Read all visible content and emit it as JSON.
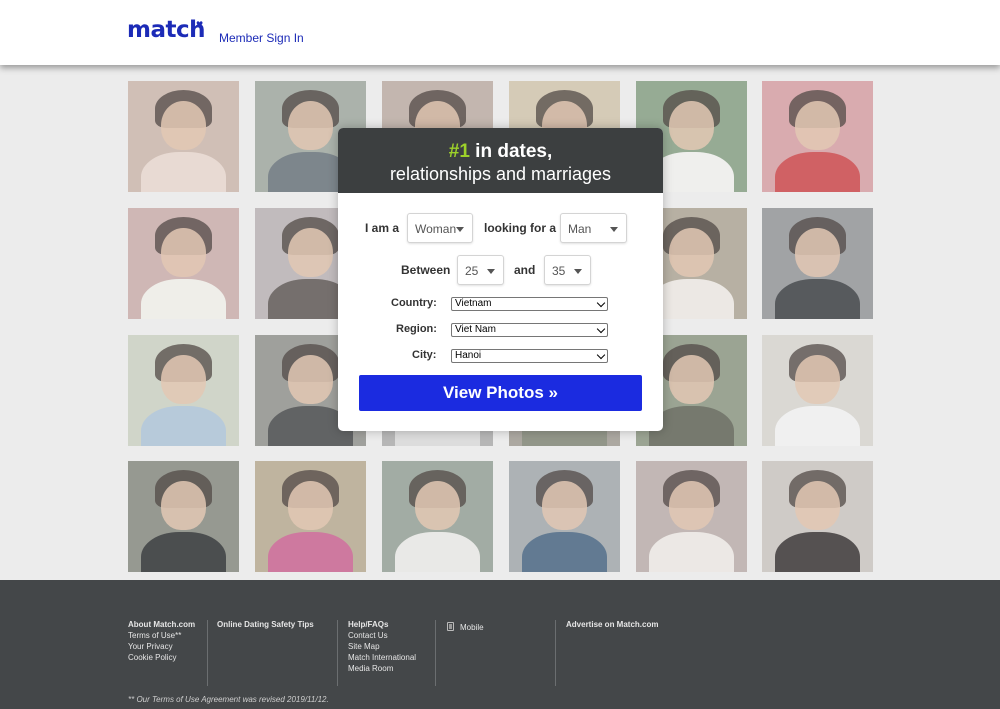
{
  "header": {
    "logo_text": "match",
    "member_sign_in": "Member Sign In"
  },
  "card": {
    "headline_number": "#1",
    "headline_rest": " in dates,",
    "subline": "relationships and marriages",
    "i_am_label": "I am a",
    "i_am_value": "Woman",
    "looking_label": "looking for a",
    "looking_value": "Man",
    "between_label": "Between",
    "age_min": "25",
    "and_label": "and",
    "age_max": "35",
    "country_label": "Country:",
    "country_value": "Vietnam",
    "region_label": "Region:",
    "region_value": "Viet Nam",
    "city_label": "City:",
    "city_value": "Hanoi",
    "button_label": "View Photos »"
  },
  "footer": {
    "col1": {
      "title": "About Match.com",
      "links": [
        "Terms of Use**",
        "Your Privacy",
        "Cookie Policy"
      ]
    },
    "col2": {
      "title": "Online Dating Safety Tips"
    },
    "col3": {
      "title": "Help/FAQs",
      "links": [
        "Contact Us",
        "Site Map",
        "Match International",
        "Media Room"
      ]
    },
    "col4": {
      "mobile_label": "Mobile"
    },
    "col5": {
      "title": "Advertise on Match.com"
    },
    "note": "** Our Terms of Use Agreement was revised 2019/11/12."
  },
  "colors": {
    "brand": "#1c2bb7",
    "button": "#1b2be0",
    "highlight": "#9dd12a",
    "card_header": "#3c3f40",
    "footer": "#444749"
  }
}
